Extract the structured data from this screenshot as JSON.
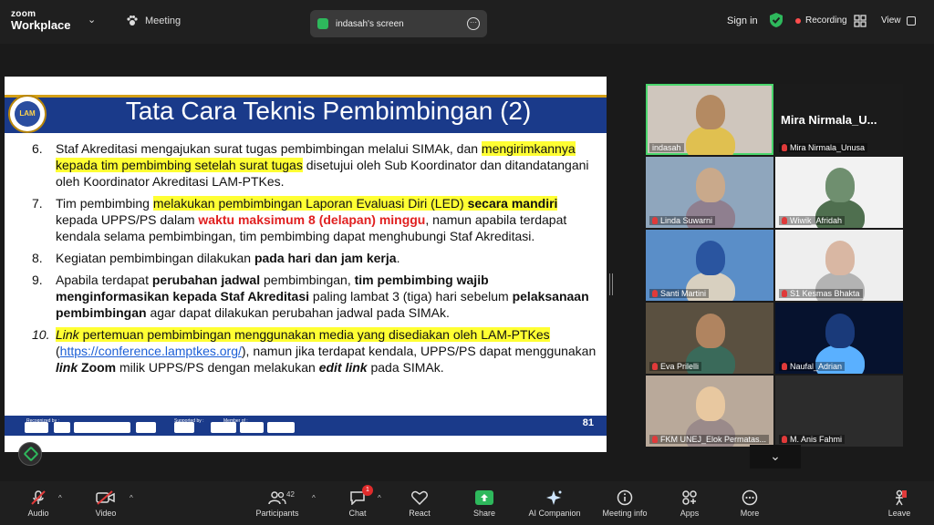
{
  "topbar": {
    "logo_line1": "zoom",
    "logo_line2": "Workplace",
    "meeting_label": "Meeting",
    "screen_tab_label": "indasah's screen",
    "sign_in": "Sign in",
    "recording": "Recording",
    "view": "View"
  },
  "slide": {
    "title": "Tata Cara Teknis Pembimbingan (2)",
    "logo_text": "LAM",
    "page_number": "81",
    "footer_labels": [
      "Recognized by :",
      "Supported by :",
      "Member of :"
    ],
    "items": [
      {
        "num": "6.",
        "parts": [
          {
            "t": "Staf Akreditasi mengajukan surat tugas pembimbingan melalui SIMAk, dan "
          },
          {
            "t": "mengirimkannya kepada tim pembimbing setelah surat tugas",
            "s": "hl"
          },
          {
            "t": " disetujui oleh Sub Koordinator dan ditandatangani oleh Koordinator Akreditasi LAM-PTKes."
          }
        ]
      },
      {
        "num": "7.",
        "parts": [
          {
            "t": "Tim pembimbing "
          },
          {
            "t": "melakukan pembimbingan Laporan Evaluasi Diri (LED) ",
            "s": "hl"
          },
          {
            "t": "secara mandiri",
            "s": "hlb"
          },
          {
            "t": " kepada UPPS/PS dalam "
          },
          {
            "t": "waktu maksimum 8 (delapan) minggu",
            "s": "red"
          },
          {
            "t": ", namun apabila terdapat kendala selama pembimbingan, tim pembimbing dapat menghubungi Staf Akreditasi."
          }
        ]
      },
      {
        "num": "8.",
        "parts": [
          {
            "t": "Kegiatan pembimbingan dilakukan "
          },
          {
            "t": "pada hari dan jam kerja",
            "s": "b"
          },
          {
            "t": "."
          }
        ]
      },
      {
        "num": "9.",
        "parts": [
          {
            "t": "Apabila terdapat "
          },
          {
            "t": "perubahan jadwal",
            "s": "b"
          },
          {
            "t": " pembimbingan, "
          },
          {
            "t": "tim pembimbing wajib menginformasikan kepada Staf Akreditasi",
            "s": "b"
          },
          {
            "t": " paling lambat 3 (tiga) hari sebelum "
          },
          {
            "t": "pelaksanaan pembimbingan",
            "s": "b"
          },
          {
            "t": " agar dapat dilakukan perubahan jadwal pada SIMAk."
          }
        ]
      },
      {
        "num": "10.",
        "num_style": "i",
        "parts": [
          {
            "t": "Link",
            "s": "hli"
          },
          {
            "t": " pertemuan pembimbingan menggunakan media yang disediakan oleh LAM-PTKes",
            "s": "hl"
          },
          {
            "t": " ("
          },
          {
            "t": "https://conference.lamptkes.org/",
            "s": "link"
          },
          {
            "t": "), namun jika terdapat kendala, UPPS/PS dapat menggunakan "
          },
          {
            "t": "link",
            "s": "bi"
          },
          {
            "t": " "
          },
          {
            "t": "Zoom",
            "s": "b"
          },
          {
            "t": " milik UPPS/PS dengan melakukan "
          },
          {
            "t": "edit link",
            "s": "bi"
          },
          {
            "t": " pada SIMAk."
          }
        ]
      }
    ]
  },
  "participants": [
    {
      "name": "indasah",
      "mic_off": false,
      "bg": "#cfc6bd",
      "face": "#b48a62",
      "cloth": "#e0c050"
    },
    {
      "name": "Mira  Nirmala_U...",
      "label": "Mira Nirmala_Unusa",
      "mic_off": true,
      "bg": "#1b1b1b"
    },
    {
      "name": "Linda Suwarni",
      "mic_off": true,
      "bg": "#8fa6bd",
      "face": "#c9a98b",
      "cloth": "#8f7f8f"
    },
    {
      "name": "Wiwik_Afridah",
      "mic_off": true,
      "bg": "#f2f2f2",
      "face": "#6f8f6f",
      "cloth": "#4f6f4f"
    },
    {
      "name": "Santi Martini",
      "mic_off": true,
      "bg": "#5a8ec8",
      "face": "#2a55a0",
      "cloth": "#d8d0c0"
    },
    {
      "name": "S1 Kesmas Bhakta",
      "mic_off": true,
      "bg": "#eeeeee",
      "face": "#d9b7a3",
      "cloth": "#b3b3b3"
    },
    {
      "name": "Eva Prilelli",
      "mic_off": true,
      "bg": "#5a5040",
      "face": "#b08460",
      "cloth": "#3a6a5a"
    },
    {
      "name": "Naufal_Adrian",
      "mic_off": true,
      "bg": "#06122e",
      "face": "#1a3a7a",
      "cloth": "#5ab0ff"
    },
    {
      "name": "FKM UNEJ_Elok Permatas...",
      "mic_off": true,
      "bg": "#b9a99a",
      "face": "#e8c8a0",
      "cloth": "#9a8a8a"
    },
    {
      "name": "M. Anis Fahmi",
      "mic_off": true,
      "bg": "#2c2c2c"
    }
  ],
  "toolbar": {
    "audio": "Audio",
    "video": "Video",
    "participants": "Participants",
    "participants_count": "42",
    "chat": "Chat",
    "chat_badge": "1",
    "react": "React",
    "share": "Share",
    "ai_companion": "AI Companion",
    "meeting_info": "Meeting info",
    "apps": "Apps",
    "more": "More",
    "leave": "Leave"
  },
  "colors": {
    "accent_green": "#2eb85c",
    "slide_header": "#1a3a8a",
    "highlight": "#ffff33",
    "emphasis_red": "#e02020"
  }
}
